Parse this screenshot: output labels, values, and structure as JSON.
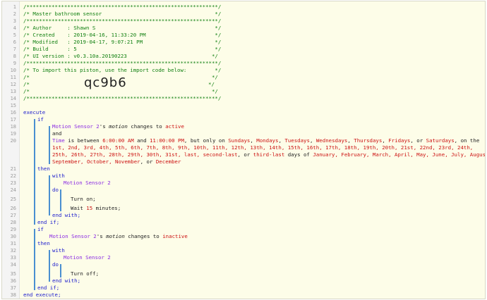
{
  "header": {
    "border": "/*************************************************************/",
    "title": "/* Master bathroom sensor                                    */",
    "author": "/* Author     : Shawn S                                      */",
    "created": "/* Created    : 2019-04-16, 11:33:20 PM                      */",
    "modified": "/* Modified   : 2019-04-17, 9:07:21 PM                       */",
    "build": "/* Build      : 5                                            */",
    "ui_version": "/* UI version : v0.3.10a.20190223                           */",
    "import_note": "/* To import this piston, use the import code below:         */",
    "blank": "/*                                                          */",
    "import_prefix": "/*",
    "import_suffix": "*/",
    "import_code": "qc9b6"
  },
  "line_numbers": [
    "1",
    "2",
    "3",
    "4",
    "5",
    "6",
    "7",
    "8",
    "9",
    "10",
    "11",
    "12",
    "13",
    "14",
    "15",
    "16",
    "17",
    "18",
    "19",
    "20",
    "21",
    "22",
    "23",
    "24",
    "25",
    "26",
    "27",
    "28",
    "29",
    "30",
    "31",
    "32",
    "33",
    "34",
    "35",
    "36",
    "37",
    "38"
  ],
  "code": {
    "execute": "execute",
    "if": "if",
    "device1": "Motion Sensor 2",
    "possessive": "'s ",
    "attr_motion": "motion",
    "changes_to": " changes to ",
    "active": "active",
    "inactive": "inactive",
    "and": "and",
    "time": "Time",
    "is_between": " is between ",
    "start_time": "6:00:00 AM",
    "and_word": " and ",
    "end_time": "11:00:00 PM",
    "but_only_on": ", but only on ",
    "sunday": "Sundays",
    "monday": "Mondays",
    "tuesday": "Tuesdays",
    "wednesday": "Wednesdays",
    "thursday": "Thursdays",
    "friday": "Fridays",
    "saturday": "Saturdays",
    "comma": ", ",
    "or": ", or ",
    "on_the": ", on the",
    "days_line1": "1st, 2nd, 3rd, 4th, 5th, 6th, 7th, 8th, 9th, 10th, 11th, 12th, 13th, 14th, 15th, 16th, 17th, 18th, 19th, 20th, 21st, 22nd, 23rd, 24th,",
    "days_line2a": "25th, 26th, 27th, 28th, 29th, 30th, 31st, last, second-last",
    "days_or": ", or ",
    "third_last": "third-last",
    "days_of": " days of ",
    "months_a": "January, February, March, April, May, June, July, August,",
    "months_b": "September, October, November",
    "or_december": ", or ",
    "december": "December",
    "then": "then",
    "with": "with",
    "do": "do",
    "turn_on": "Turn on;",
    "wait_prefix": "Wait ",
    "wait_value": "15",
    "wait_suffix": " minutes;",
    "end_with": "end with;",
    "end_if": "end if;",
    "turn_off": "Turn off;",
    "end_execute": "end execute;"
  }
}
